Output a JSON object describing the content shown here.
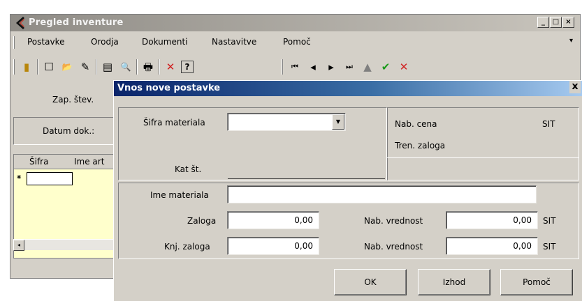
{
  "main_window": {
    "title": "Pregled inventure",
    "controls": {
      "minimize": "_",
      "maximize": "□",
      "close": "×"
    },
    "menu": [
      "Postavke",
      "Orodja",
      "Dokumenti",
      "Nastavitve",
      "Pomoč"
    ],
    "menu_overflow": "▾",
    "toolbar_icons": [
      "chart-icon",
      "new-document-icon",
      "open-folder-icon",
      "eraser-icon",
      "print-preview-icon",
      "zoom-icon",
      "printer-icon",
      "delete-icon",
      "help-icon",
      "first-record-icon",
      "previous-record-icon",
      "next-record-icon",
      "last-record-icon",
      "up-icon",
      "confirm-icon",
      "cancel-icon"
    ],
    "toolbar_glyphs": [
      "▮",
      "☐",
      "📂",
      "✎",
      "▤",
      "🔍",
      "🖶",
      "✕",
      "?",
      "⏮",
      "◂",
      "▸",
      "⏭",
      "▲",
      "✔",
      "✕"
    ],
    "labels": {
      "zap_stev": "Zap. štev.",
      "datum_dok": "Datum dok.:"
    },
    "grid": {
      "columns": [
        "Šifra",
        "Ime art"
      ],
      "new_row_marker": "*"
    },
    "scroll_left": "◂"
  },
  "dialog": {
    "title": "Vnos nove postavke",
    "close": "x",
    "sifra_materiala": {
      "label": "Šifra materiala",
      "value": ""
    },
    "kat_st": {
      "label": "Kat št."
    },
    "nab_cena": {
      "label": "Nab. cena",
      "unit": "SIT"
    },
    "tren_zaloga": {
      "label": "Tren. zaloga"
    },
    "ime_materiala": {
      "label": "Ime materiala",
      "value": ""
    },
    "zaloga": {
      "label": "Zaloga",
      "value": "0,00"
    },
    "knj_zaloga": {
      "label": "Knj. zaloga",
      "value": "0,00"
    },
    "nab_vrednost_1": {
      "label": "Nab. vrednost",
      "value": "0,00",
      "unit": "SIT"
    },
    "nab_vrednost_2": {
      "label": "Nab. vrednost",
      "value": "0,00",
      "unit": "SIT"
    },
    "buttons": {
      "ok": "OK",
      "izhod": "Izhod",
      "pomoc": "Pomoč"
    }
  },
  "colors": {
    "dialog_title_start": "#0a246a",
    "dialog_title_end": "#a6caf0",
    "window_face": "#d4d0c8",
    "grid_background": "#ffffcc",
    "delete_red": "#d02020",
    "confirm_green": "#1a9a1a"
  }
}
